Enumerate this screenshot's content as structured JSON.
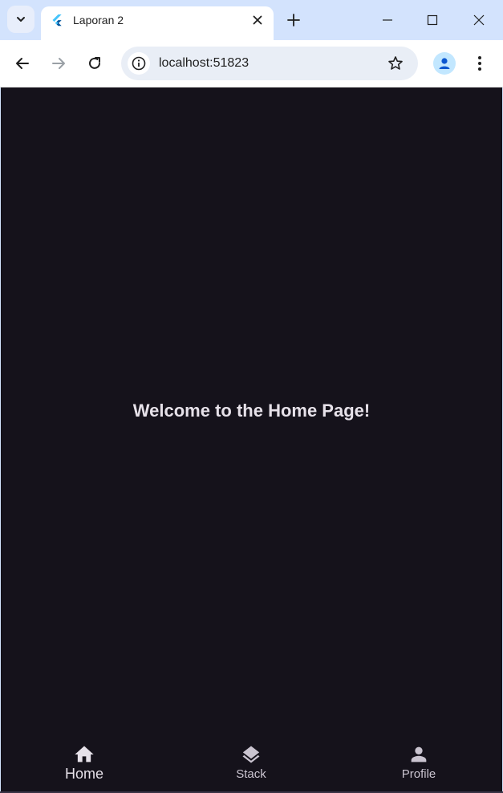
{
  "browser": {
    "tab_title": "Laporan 2",
    "url": "localhost:51823"
  },
  "app": {
    "welcome_text": "Welcome to the Home Page!",
    "bottom_nav": {
      "items": [
        {
          "label": "Home",
          "icon": "home-icon",
          "selected": true
        },
        {
          "label": "Stack",
          "icon": "layers-icon",
          "selected": false
        },
        {
          "label": "Profile",
          "icon": "person-icon",
          "selected": false
        }
      ]
    }
  },
  "colors": {
    "chrome_frame": "#d3e3fd",
    "app_background": "#15121b",
    "text_primary": "#e6e1e9",
    "text_secondary": "#cac4d0"
  }
}
